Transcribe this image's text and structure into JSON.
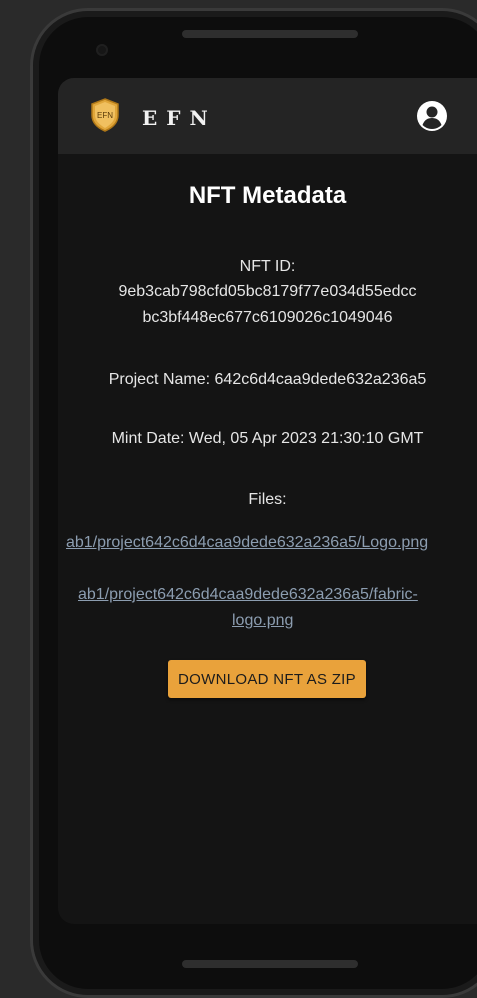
{
  "header": {
    "brand": "EFN",
    "logo_text": "EFN",
    "logo_icon": "efn-shield-logo",
    "account_icon": "account-circle-icon"
  },
  "page": {
    "title": "NFT Metadata",
    "nft_id_label": "NFT ID:",
    "nft_id_line1": "9eb3cab798cfd05bc8179f77e034d55edcc",
    "nft_id_line2": "bc3bf448ec677c6109026c1049046",
    "project_name": "Project Name: 642c6d4caa9dede632a236a5",
    "mint_date": "Mint Date: Wed, 05 Apr 2023 21:30:10 GMT",
    "files_label": "Files:",
    "files": [
      "ab1/project642c6d4caa9dede632a236a5/Logo.png",
      "ab1/project642c6d4caa9dede632a236a5/fabric-",
      "logo.png"
    ],
    "download_button": "DOWNLOAD NFT AS ZIP"
  },
  "colors": {
    "accent": "#e9a23b",
    "link": "#8c9db0",
    "appbar": "#242424",
    "background": "#141414"
  }
}
